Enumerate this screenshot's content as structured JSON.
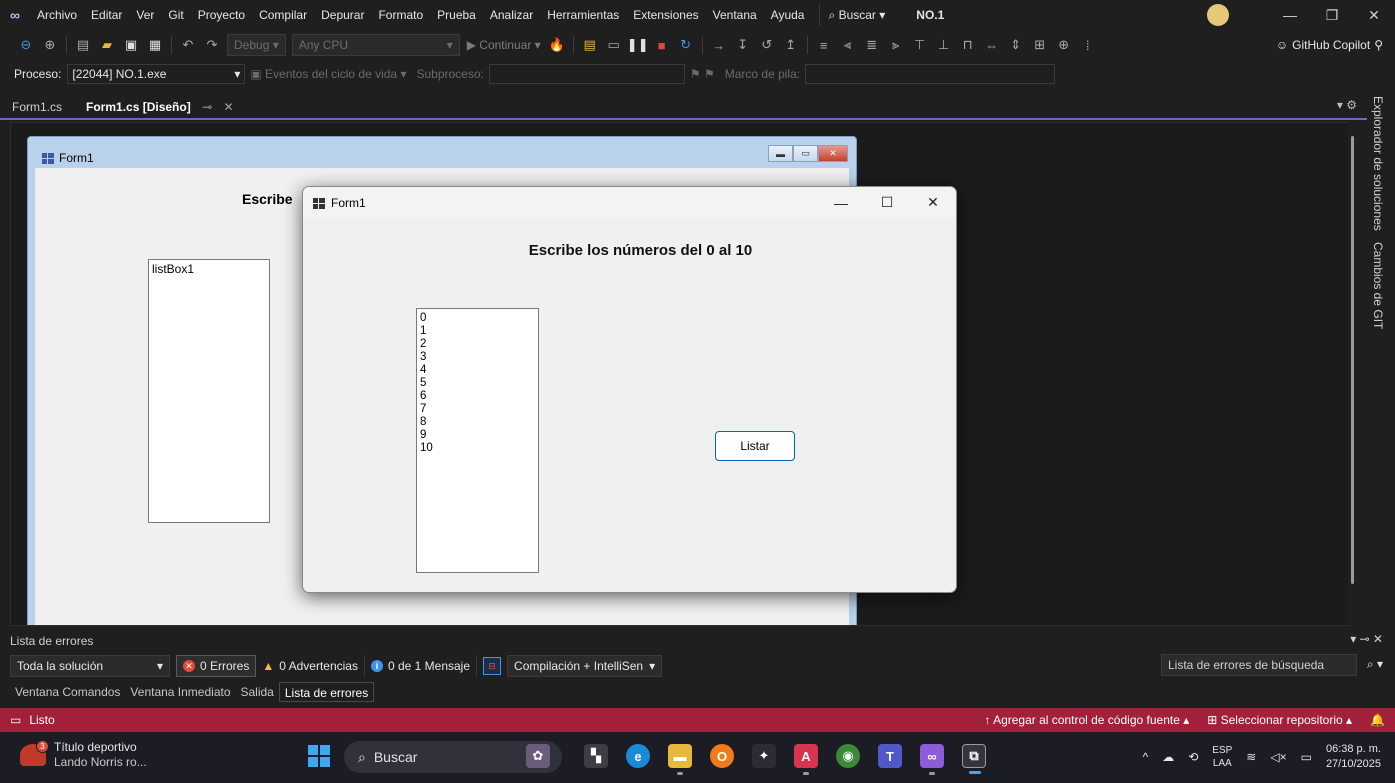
{
  "menubar": {
    "items": [
      "Archivo",
      "Editar",
      "Ver",
      "Git",
      "Proyecto",
      "Compilar",
      "Depurar",
      "Formato",
      "Prueba",
      "Analizar",
      "Herramientas",
      "Extensiones",
      "Ventana",
      "Ayuda"
    ],
    "search_label": "Buscar",
    "solution_name": "NO.1"
  },
  "toolbar": {
    "config": "Debug",
    "platform": "Any CPU",
    "continue_label": "Continuar",
    "copilot_label": "GitHub Copilot"
  },
  "debugbar": {
    "process_label": "Proceso:",
    "process_value": "[22044] NO.1.exe",
    "lifecycle_label": "Eventos del ciclo de vida",
    "thread_label": "Subproceso:",
    "stack_label": "Marco de pila:"
  },
  "tabs": [
    {
      "label": "Form1.cs"
    },
    {
      "label": "Form1.cs [Diseño]"
    }
  ],
  "side_tabs": [
    "Explorador de soluciones",
    "Cambios de GIT"
  ],
  "design_form": {
    "title": "Form1",
    "heading_visible": "Escribe",
    "listbox_label": "listBox1"
  },
  "run_form": {
    "title": "Form1",
    "heading": "Escribe los números del 0 al 10",
    "list_items": [
      "0",
      "1",
      "2",
      "3",
      "4",
      "5",
      "6",
      "7",
      "8",
      "9",
      "10"
    ],
    "button_label": "Listar"
  },
  "error_list": {
    "title": "Lista de errores",
    "scope": "Toda la solución",
    "errors": "0 Errores",
    "warnings": "0 Advertencias",
    "messages": "0 de 1 Mensaje",
    "build_filter": "Compilación + IntelliSen",
    "search_placeholder": "Lista de errores de búsqueda",
    "bottom_tabs": [
      "Ventana Comandos",
      "Ventana Inmediato",
      "Salida",
      "Lista de errores"
    ]
  },
  "statusbar": {
    "ready": "Listo",
    "add_source_control": "Agregar al control de código fuente",
    "select_repo": "Seleccionar repositorio"
  },
  "taskbar": {
    "news_title": "Título deportivo",
    "news_sub": "Lando Norris ro...",
    "news_badge": "3",
    "search": "Buscar",
    "lang_top": "ESP",
    "lang_bottom": "LAA",
    "time": "06:38 p. m.",
    "date": "27/10/2025"
  },
  "colors": {
    "statusbar": "#a3203b",
    "accent": "#7a5fc6",
    "ide_background": "#1f1f1f"
  }
}
